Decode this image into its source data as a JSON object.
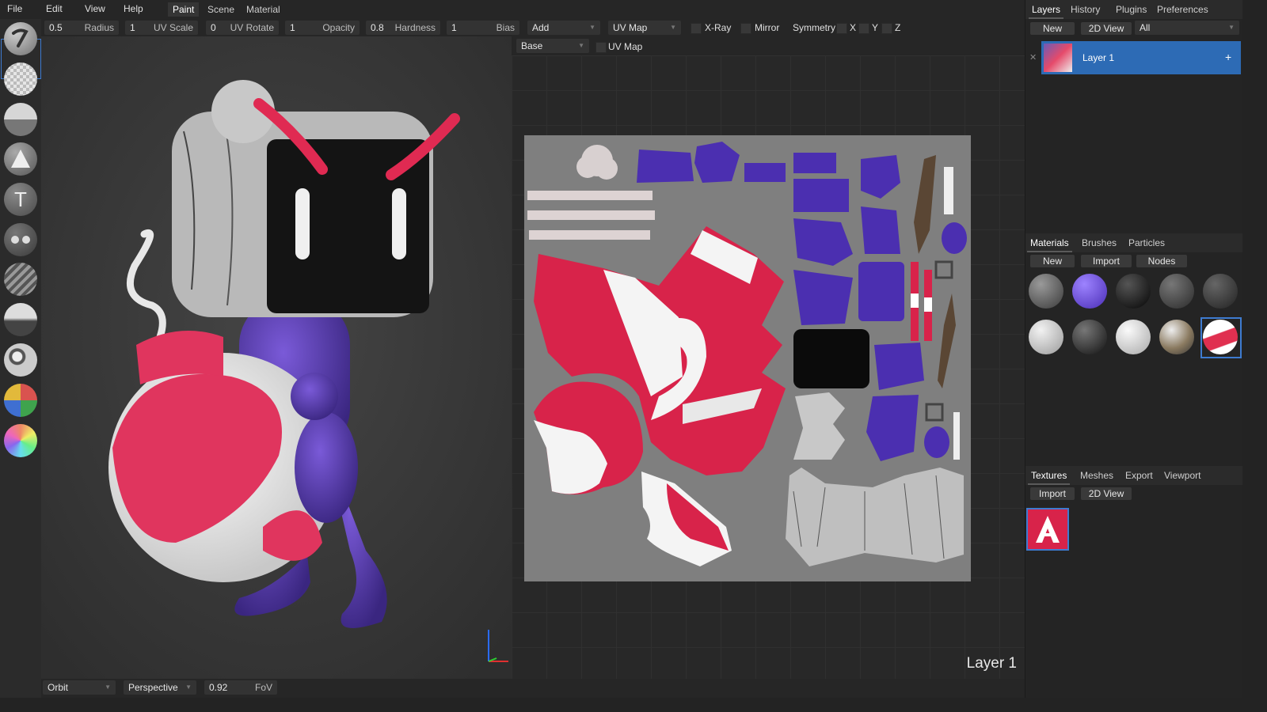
{
  "menu": {
    "file": "File",
    "edit": "Edit",
    "view": "View",
    "help": "Help"
  },
  "workspace_tabs": [
    "Paint",
    "Scene",
    "Material"
  ],
  "toolbar": {
    "radius": {
      "value": "0.5",
      "label": "Radius"
    },
    "uv_scale": {
      "value": "1",
      "label": "UV Scale"
    },
    "uv_rotate": {
      "value": "0",
      "label": "UV Rotate"
    },
    "opacity": {
      "value": "1",
      "label": "Opacity"
    },
    "hardness": {
      "value": "0.8",
      "label": "Hardness"
    },
    "bias": {
      "value": "1",
      "label": "Bias"
    },
    "blend_mode": "Add",
    "tex_coord": "UV Map",
    "xray": "X-Ray",
    "mirror": "Mirror",
    "symmetry": "Symmetry",
    "sym_x": "X",
    "sym_y": "Y",
    "sym_z": "Z"
  },
  "tools": [
    "brush-icon",
    "eraser-icon",
    "fill-icon",
    "decal-icon",
    "text-icon",
    "clone-icon",
    "blur-icon",
    "smudge-icon",
    "particle-icon",
    "colorid-icon",
    "picker-icon"
  ],
  "uv_header": {
    "layer_dropdown": "Base",
    "uv_label": "UV Map"
  },
  "uv_view": {
    "layer_label": "Layer 1"
  },
  "bottom": {
    "nav_mode": "Orbit",
    "camera_type": "Perspective",
    "fov": {
      "value": "0.92",
      "label": "FoV"
    }
  },
  "right_top": {
    "tabs": [
      "Layers",
      "History",
      "Plugins",
      "Preferences"
    ],
    "new_label": "New",
    "view2d_label": "2D View",
    "filter": "All",
    "layer_name": "Layer 1"
  },
  "right_mid": {
    "tabs": [
      "Materials",
      "Brushes",
      "Particles"
    ],
    "new_label": "New",
    "import_label": "Import",
    "nodes_label": "Nodes"
  },
  "right_bot": {
    "tabs": [
      "Textures",
      "Meshes",
      "Export",
      "Viewport"
    ],
    "import_label": "Import",
    "view2d_label": "2D View"
  },
  "colors": {
    "accent": "#3e7bd0",
    "layer_selected": "#2d6bb5",
    "red": "#d82a4a",
    "purple": "#5a3fb0"
  }
}
